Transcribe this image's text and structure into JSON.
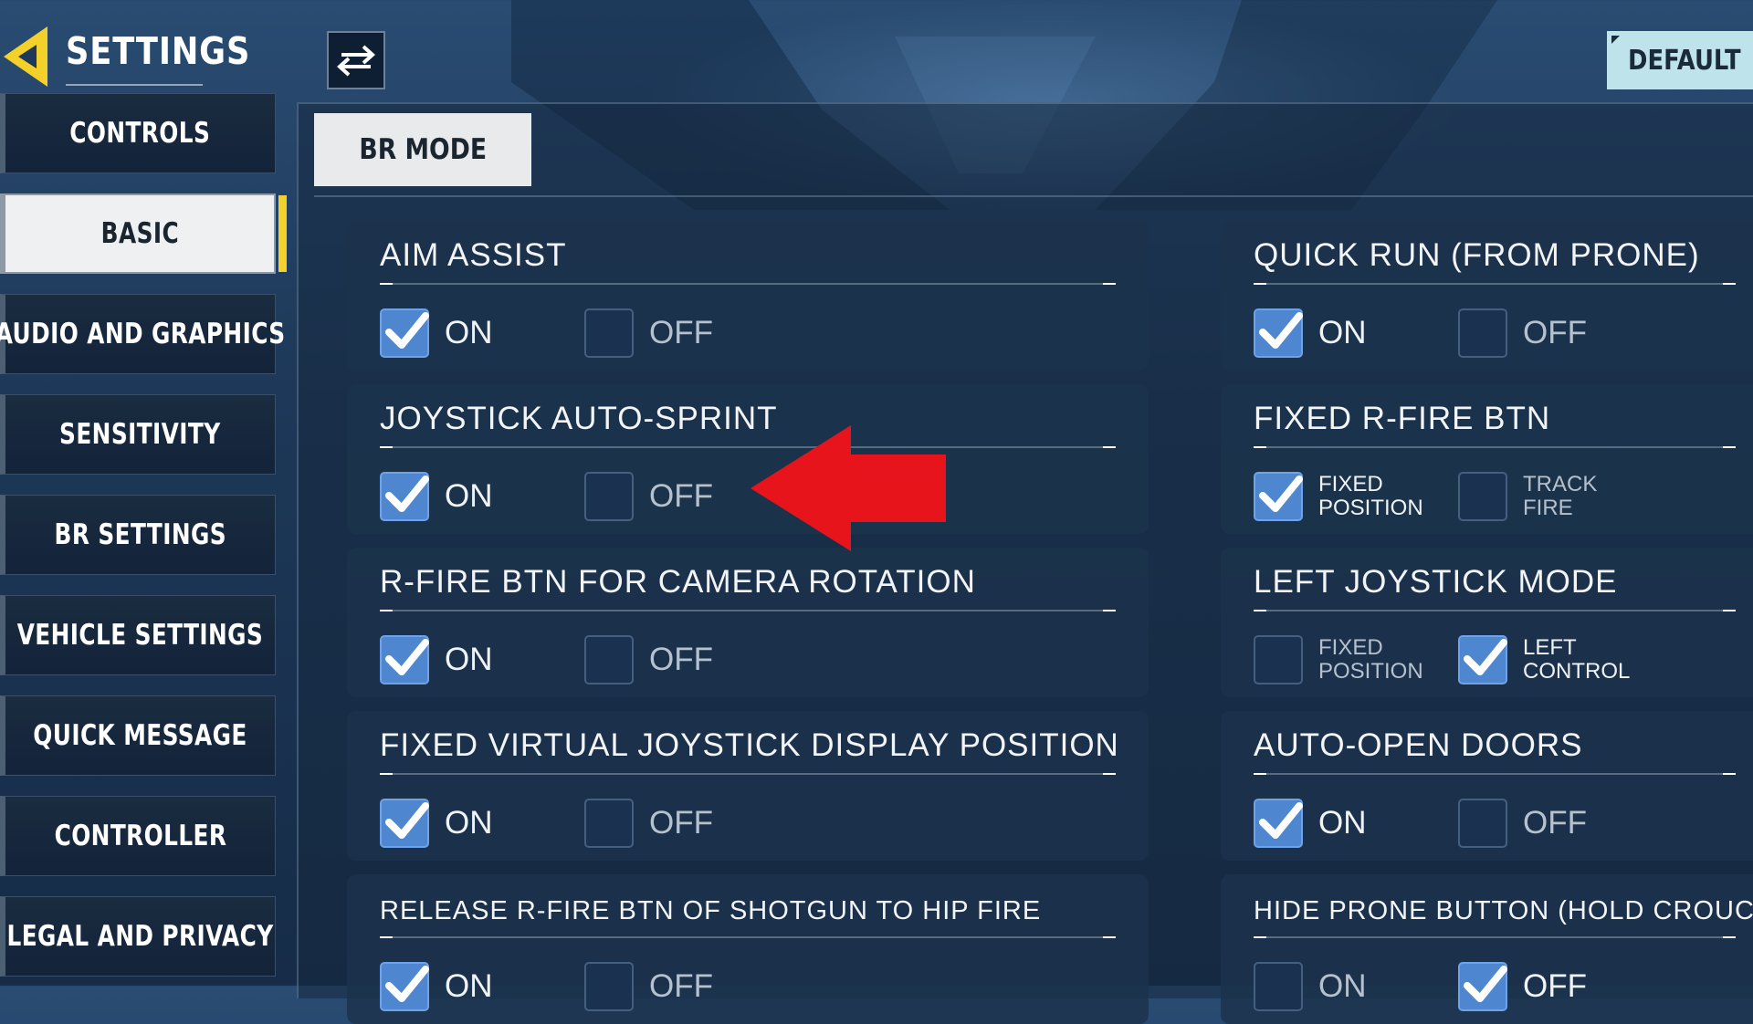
{
  "header": {
    "title": "SETTINGS",
    "default_label": "DEFAULT"
  },
  "sidebar": {
    "items": [
      {
        "label": "CONTROLS",
        "active": false
      },
      {
        "label": "BASIC",
        "active": true
      },
      {
        "label": "AUDIO AND GRAPHICS",
        "active": false
      },
      {
        "label": "SENSITIVITY",
        "active": false
      },
      {
        "label": "BR SETTINGS",
        "active": false
      },
      {
        "label": "VEHICLE SETTINGS",
        "active": false
      },
      {
        "label": "QUICK MESSAGE",
        "active": false
      },
      {
        "label": "CONTROLLER",
        "active": false
      },
      {
        "label": "LEGAL AND PRIVACY",
        "active": false
      }
    ]
  },
  "mode_tab": "BR MODE",
  "left_settings": [
    {
      "title": "AIM ASSIST",
      "opt1": "ON",
      "opt2": "OFF",
      "selected": 1
    },
    {
      "title": "JOYSTICK AUTO-SPRINT",
      "opt1": "ON",
      "opt2": "OFF",
      "selected": 1
    },
    {
      "title": "R-FIRE BTN FOR CAMERA ROTATION",
      "opt1": "ON",
      "opt2": "OFF",
      "selected": 1
    },
    {
      "title": "FIXED VIRTUAL JOYSTICK DISPLAY POSITION",
      "opt1": "ON",
      "opt2": "OFF",
      "selected": 1
    },
    {
      "title": "RELEASE R-FIRE BTN OF SHOTGUN TO HIP FIRE",
      "opt1": "ON",
      "opt2": "OFF",
      "selected": 1
    }
  ],
  "right_settings": [
    {
      "title": "QUICK RUN (FROM PRONE)",
      "opt1": "ON",
      "opt2": "OFF",
      "selected": 1
    },
    {
      "title": "FIXED R-FIRE BTN",
      "opt1": "FIXED\nPOSITION",
      "opt2": "TRACK\nFIRE",
      "selected": 1
    },
    {
      "title": "LEFT JOYSTICK MODE",
      "opt1": "FIXED\nPOSITION",
      "opt2": "LEFT\nCONTROL",
      "selected": 2
    },
    {
      "title": "AUTO-OPEN DOORS",
      "opt1": "ON",
      "opt2": "OFF",
      "selected": 1
    },
    {
      "title": "HIDE PRONE BUTTON (HOLD CROUCH T",
      "opt1": "ON",
      "opt2": "OFF",
      "selected": 2
    }
  ],
  "colors": {
    "accent_yellow": "#f3d02a",
    "checkbox_blue": "#4f86d0",
    "annotation_red": "#e8141c"
  },
  "icons": {
    "back": "back-arrow-icon",
    "swap": "swap-arrows-icon",
    "check": "checkmark-icon",
    "annotation": "red-arrow-pointer"
  }
}
